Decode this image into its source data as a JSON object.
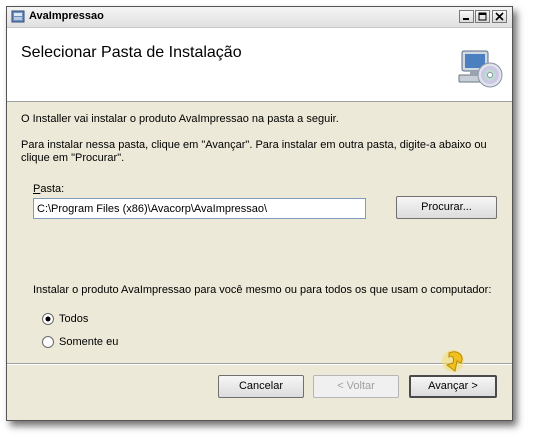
{
  "window": {
    "title": "AvaImpressao",
    "controls": {
      "minimize": "minimize-icon",
      "maximize": "maximize-icon",
      "close": "close-icon"
    }
  },
  "header": {
    "title": "Selecionar Pasta de Instalação",
    "icon": "computer-cd-icon"
  },
  "body": {
    "intro": "O Installer vai instalar o produto AvaImpressao na pasta a seguir.",
    "instructions": "Para instalar nessa pasta, clique em \"Avançar\". Para instalar em outra pasta, digite-a abaixo ou clique em \"Procurar\".",
    "folder_label_accel": "P",
    "folder_label_rest": "asta:",
    "folder_value": "C:\\Program Files (x86)\\Avacorp\\AvaImpressao\\",
    "browse_label": "Procurar...",
    "scope_question": "Instalar o produto AvaImpressao para você mesmo ou para todos os que usam o computador:",
    "options": [
      {
        "label": "Todos",
        "selected": true
      },
      {
        "label": "Somente eu",
        "selected": false
      }
    ]
  },
  "footer": {
    "cancel_label": "Cancelar",
    "back_label": "< Voltar",
    "next_label": "Avançar >"
  },
  "colors": {
    "dialog_bg": "#ece9d8",
    "input_border": "#7f9db9",
    "cursor_highlight": "#f0c020"
  }
}
